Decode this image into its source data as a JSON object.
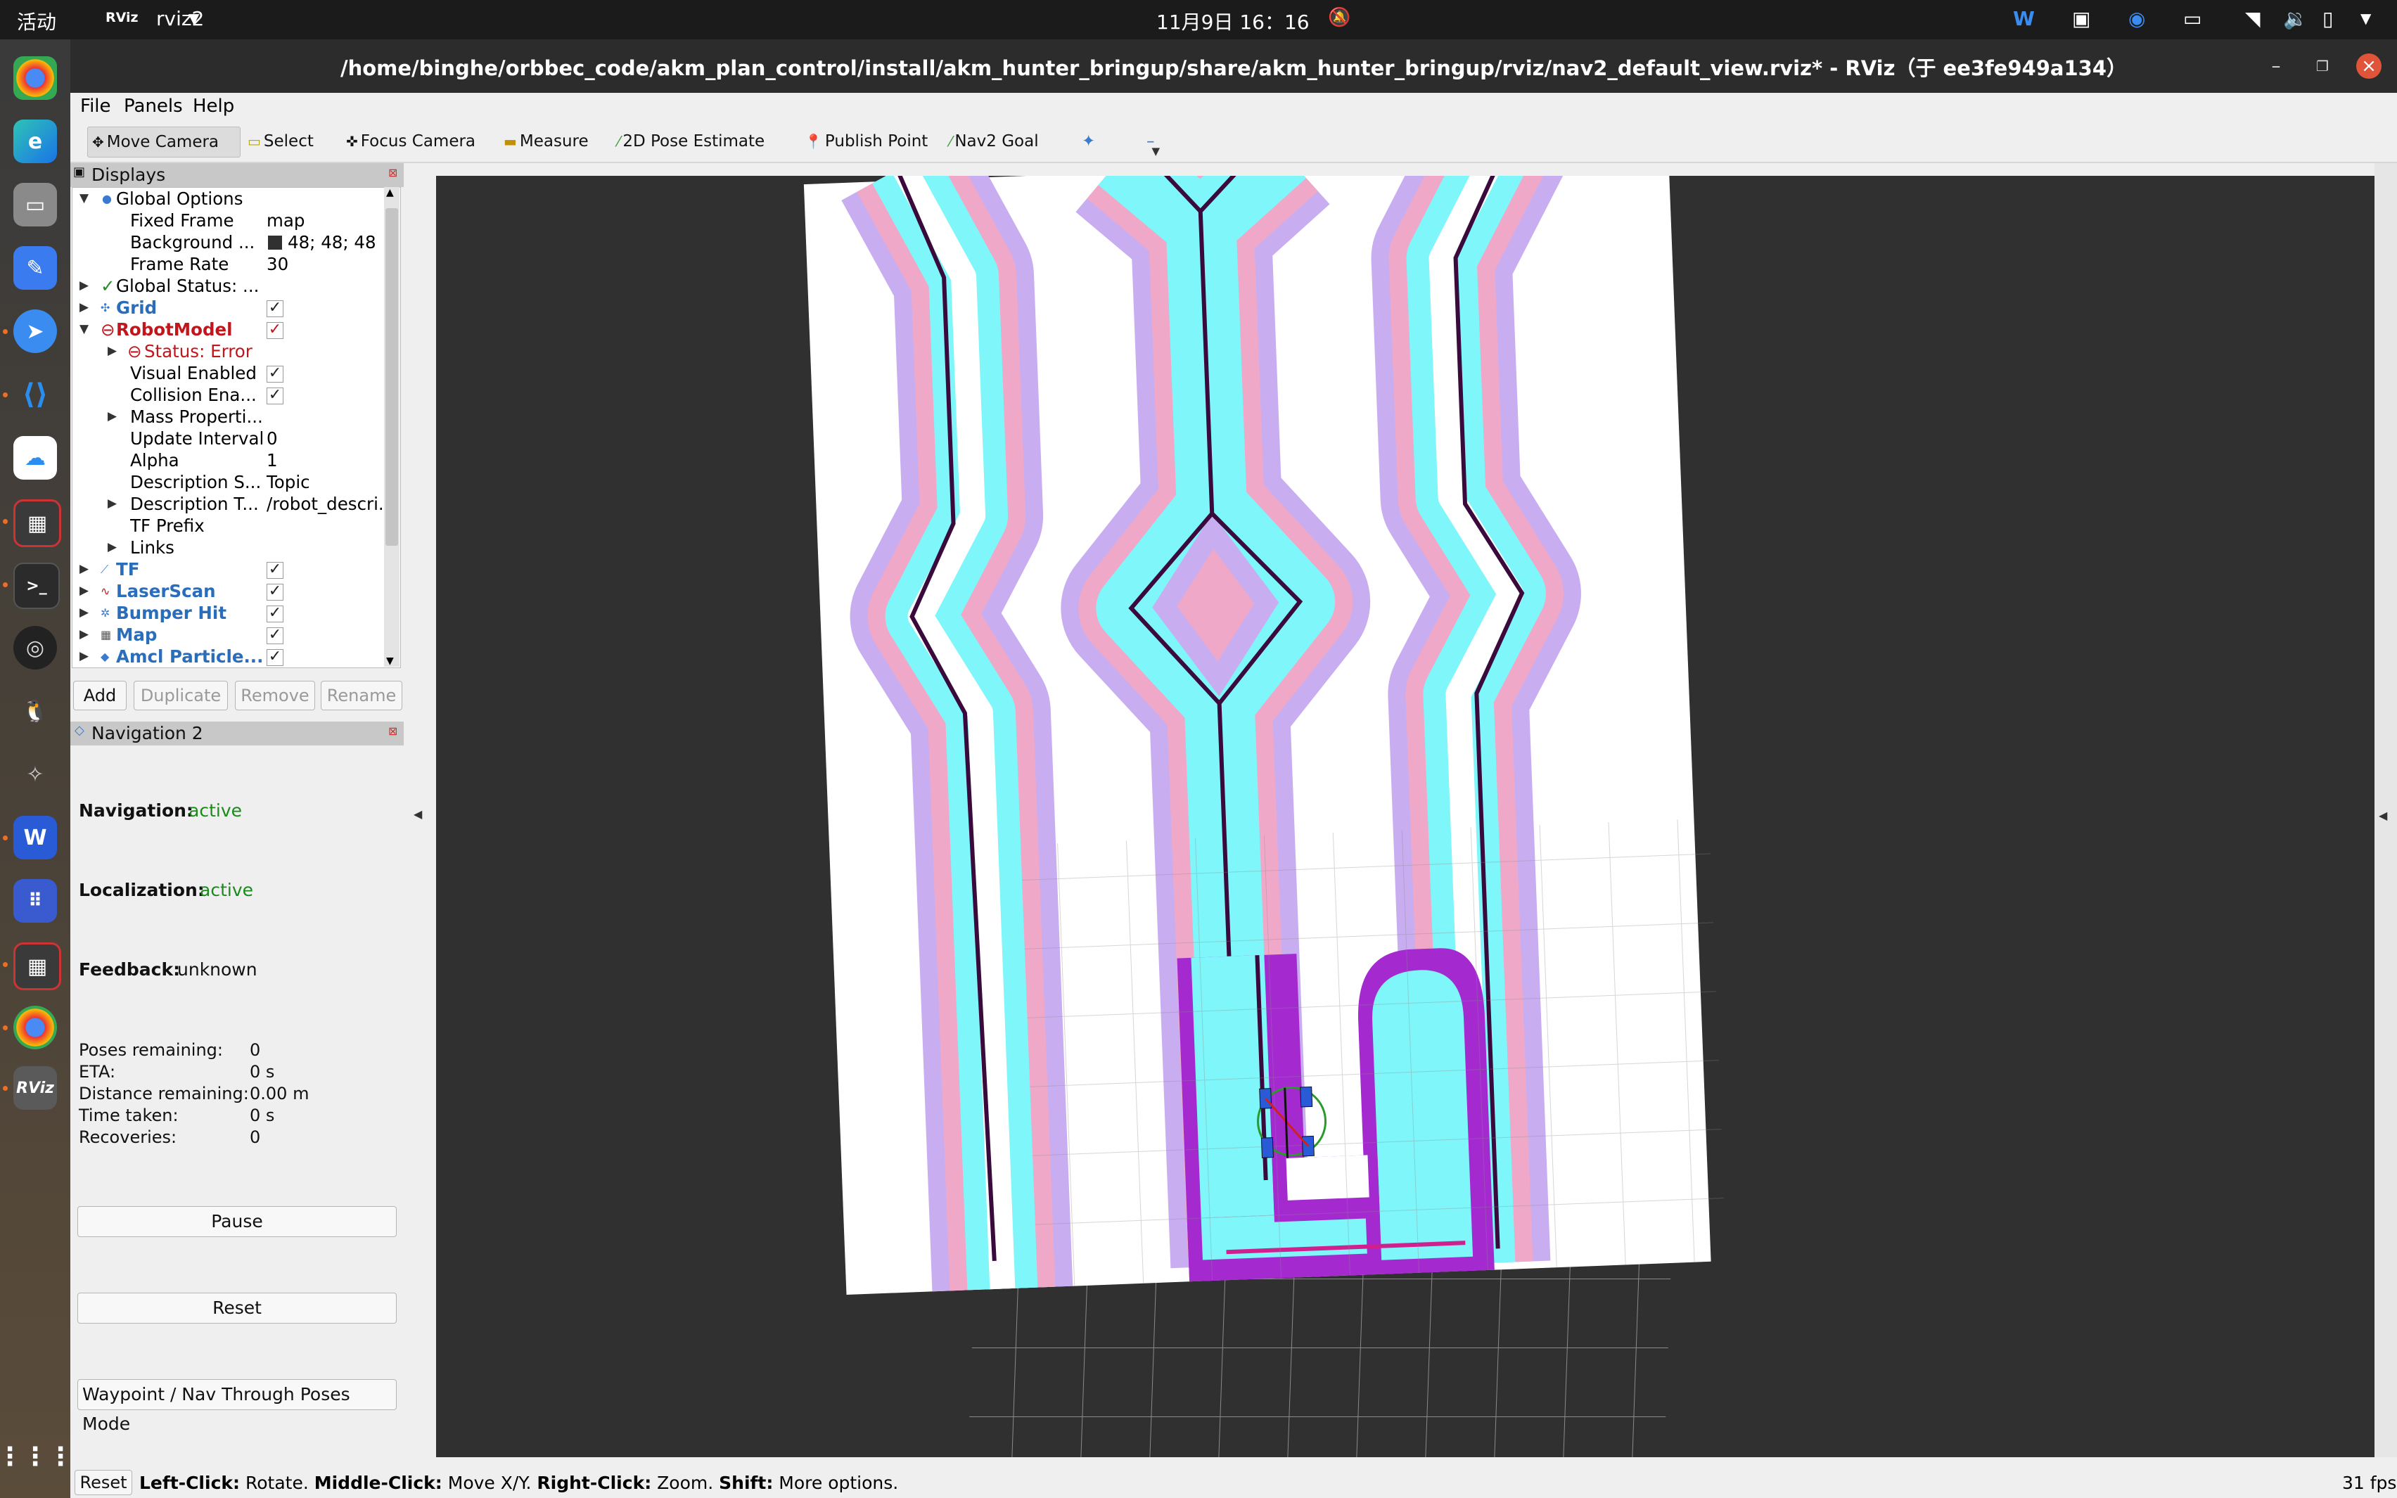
{
  "topbar": {
    "activities": "活动",
    "app_menu": "rviz2",
    "clock": "11月9日 16：16",
    "tray_icons": [
      "wps-icon",
      "screen-icon",
      "feishu-icon",
      "keyboard-icon",
      "wifi-icon",
      "volume-icon",
      "battery-icon",
      "power-menu-icon"
    ]
  },
  "dock": {
    "apps": [
      "chrome",
      "edge",
      "files",
      "notes",
      "feishu",
      "vscode",
      "baidu-netdisk",
      "terminal-red",
      "terminal",
      "obs",
      "qq",
      "gimp",
      "wps",
      "app-grid-9",
      "terminal-red-2",
      "chrome-2",
      "rviz"
    ],
    "rviz_label": "RViz"
  },
  "window": {
    "title": "/home/binghe/orbbec_code/akm_plan_control/install/akm_hunter_bringup/share/akm_hunter_bringup/rviz/nav2_default_view.rviz* - RViz（于 ee3fe949a134）"
  },
  "menu": {
    "file": "File",
    "panels": "Panels",
    "help": "Help"
  },
  "toolbar": {
    "move_camera": "Move Camera",
    "select": "Select",
    "focus_camera": "Focus Camera",
    "measure": "Measure",
    "pose_estimate": "2D Pose Estimate",
    "publish_point": "Publish Point",
    "nav2_goal": "Nav2 Goal"
  },
  "displays": {
    "title": "Displays",
    "rows": [
      {
        "name": "Global Options",
        "value": ""
      },
      {
        "name": "Fixed Frame",
        "value": "map"
      },
      {
        "name": "Background ...",
        "value": "48; 48; 48"
      },
      {
        "name": "Frame Rate",
        "value": "30"
      },
      {
        "name": "Global Status: ...",
        "value": ""
      },
      {
        "name": "Grid",
        "value": "✓"
      },
      {
        "name": "RobotModel",
        "value": "✓"
      },
      {
        "name": "Status: Error",
        "value": ""
      },
      {
        "name": "Visual Enabled",
        "value": "✓"
      },
      {
        "name": "Collision Ena...",
        "value": "✓"
      },
      {
        "name": "Mass Properti...",
        "value": ""
      },
      {
        "name": "Update Interval",
        "value": "0"
      },
      {
        "name": "Alpha",
        "value": "1"
      },
      {
        "name": "Description S...",
        "value": "Topic"
      },
      {
        "name": "Description T...",
        "value": "/robot_descri..."
      },
      {
        "name": "TF Prefix",
        "value": ""
      },
      {
        "name": "Links",
        "value": ""
      },
      {
        "name": "TF",
        "value": "✓"
      },
      {
        "name": "LaserScan",
        "value": "✓"
      },
      {
        "name": "Bumper Hit",
        "value": "✓"
      },
      {
        "name": "Map",
        "value": "✓"
      },
      {
        "name": "Amcl Particle...",
        "value": "✓"
      }
    ],
    "buttons": {
      "add": "Add",
      "duplicate": "Duplicate",
      "remove": "Remove",
      "rename": "Rename"
    }
  },
  "nav2": {
    "title": "Navigation 2",
    "navigation_label": "Navigation:",
    "navigation_value": "active",
    "localization_label": "Localization:",
    "localization_value": "active",
    "feedback_label": "Feedback:",
    "feedback_value": "unknown",
    "stats": [
      {
        "label": "Poses remaining:",
        "value": "0"
      },
      {
        "label": "ETA:",
        "value": "0 s"
      },
      {
        "label": "Distance remaining:",
        "value": "0.00 m"
      },
      {
        "label": "Time taken:",
        "value": "0 s"
      },
      {
        "label": "Recoveries:",
        "value": "0"
      }
    ],
    "pause": "Pause",
    "reset": "Reset",
    "waypoint_mode": "Waypoint / Nav Through Poses Mode"
  },
  "statusbar": {
    "reset": "Reset",
    "left_click_key": "Left-Click:",
    "left_click_desc": "Rotate.",
    "middle_click_key": "Middle-Click:",
    "middle_click_desc": "Move X/Y.",
    "right_click_key": "Right-Click:",
    "right_click_desc": "Zoom.",
    "shift_key": "Shift:",
    "shift_desc": "More options.",
    "fps": "31 fps"
  },
  "colors": {
    "viewport_bg": "#303030",
    "costmap_cyan": "#7ff6fa",
    "costmap_pink": "#f0a8c8",
    "costmap_lavender": "#c8aef0",
    "wall": "#3a0a3c",
    "local_costmap": "#a42ad0",
    "status_active": "#1a8a1a",
    "error_red": "#c0161c",
    "display_blue": "#2a6ebb"
  }
}
